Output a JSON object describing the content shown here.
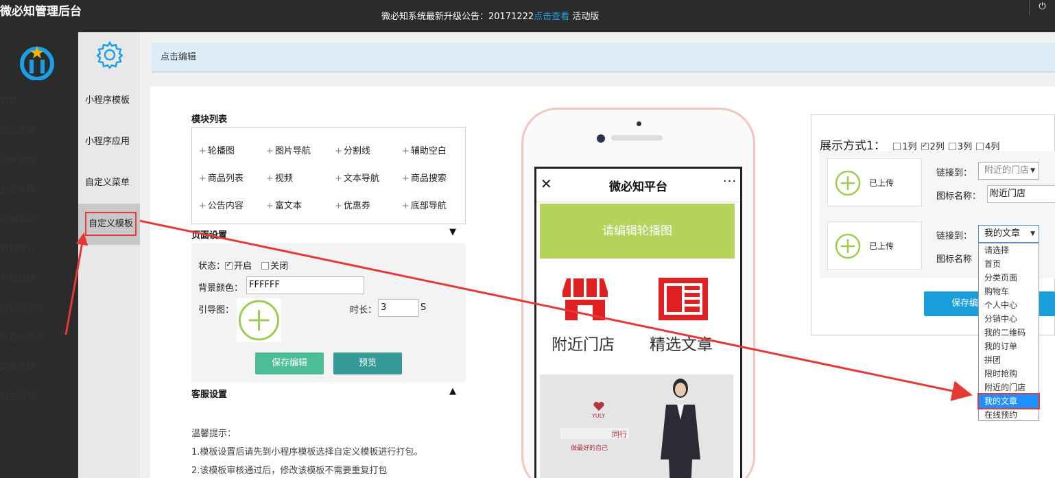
{
  "header": {
    "app_title": "微必知管理后台",
    "notice_text": "微必知系统最新升级公告：20171222",
    "notice_link": "点击查看",
    "notice_suffix": " 活动版",
    "power_icon": "⏻"
  },
  "nav": {
    "items": [
      {
        "label": "首页"
      },
      {
        "label": "商品管理"
      },
      {
        "label": "订单管理"
      },
      {
        "label": "会员管理"
      },
      {
        "label": "促销活动"
      },
      {
        "label": "数据统计"
      },
      {
        "label": "分销管理"
      },
      {
        "label": "微信公众号"
      },
      {
        "label": "微信小程序"
      },
      {
        "label": "文章管理"
      },
      {
        "label": "后台设置"
      }
    ],
    "active_index": 8
  },
  "subnav": {
    "items": [
      {
        "label": "小程序模板"
      },
      {
        "label": "小程序应用"
      },
      {
        "label": "自定义菜单"
      },
      {
        "label": "自定义模板"
      }
    ],
    "active_index": 3
  },
  "banner": {
    "text": "点击编辑"
  },
  "modules": {
    "title": "模块列表",
    "items": [
      "轮播图",
      "图片导航",
      "分割线",
      "辅助空白",
      "商品列表",
      "视频",
      "文本导航",
      "商品搜索",
      "公告内容",
      "富文本",
      "优惠券",
      "底部导航"
    ]
  },
  "page_settings": {
    "title": "页面设置",
    "collapse_icon": "▼",
    "status_label": "状态：",
    "open_label": "开启",
    "close_label": "关闭",
    "open_checked": true,
    "bg_label": "背景颜色：",
    "bg_value": "FFFFFF",
    "guide_label": "引导图：",
    "duration_label": "时长：",
    "duration_value": "3",
    "duration_unit": "S",
    "save_button": "保存编辑",
    "preview_button": "预览"
  },
  "service": {
    "title": "客服设置",
    "expand_icon": "▲"
  },
  "tips": {
    "title": "温馨提示：",
    "line1": "1.模板设置后请先到小程序模板选择自定义模板进行打包。",
    "line2": "2.该模板审核通过后，修改该模板不需要重复打包"
  },
  "phone": {
    "title": "微必知平台",
    "close_icon": "✕",
    "more_icon": "···",
    "carousel_text": "请编辑轮播图",
    "nav1_label": "附近门店",
    "nav2_label": "精选文章",
    "photo_brand": "YULY",
    "photo_text1": "同行",
    "photo_text2": "做最好的自己"
  },
  "display": {
    "label": "展示方式1：",
    "options": [
      {
        "label": "1列",
        "checked": false
      },
      {
        "label": "2列",
        "checked": true
      },
      {
        "label": "3列",
        "checked": false
      },
      {
        "label": "4列",
        "checked": false
      }
    ],
    "uploaded_text": "已上传",
    "link_label": "链接到：",
    "name_label": "图标名称：",
    "name_label_short": "图标名称",
    "link1_value": "附近的门店",
    "name1_value": "附近门店",
    "link2_value": "我的文章",
    "save_button": "保存编",
    "select_arrow": "▼"
  },
  "dropdown": {
    "options": [
      "请选择",
      "首页",
      "分类页面",
      "购物车",
      "个人中心",
      "分销中心",
      "我的二维码",
      "我的订单",
      "拼团",
      "限时抢购",
      "附近的门店",
      "我的文章",
      "在线预约"
    ],
    "selected_index": 11
  },
  "colors": {
    "accent": "#179edb",
    "highlight": "#e53935",
    "green": "#8cc63f",
    "save": "#4cbe96",
    "preview": "#339a98"
  }
}
